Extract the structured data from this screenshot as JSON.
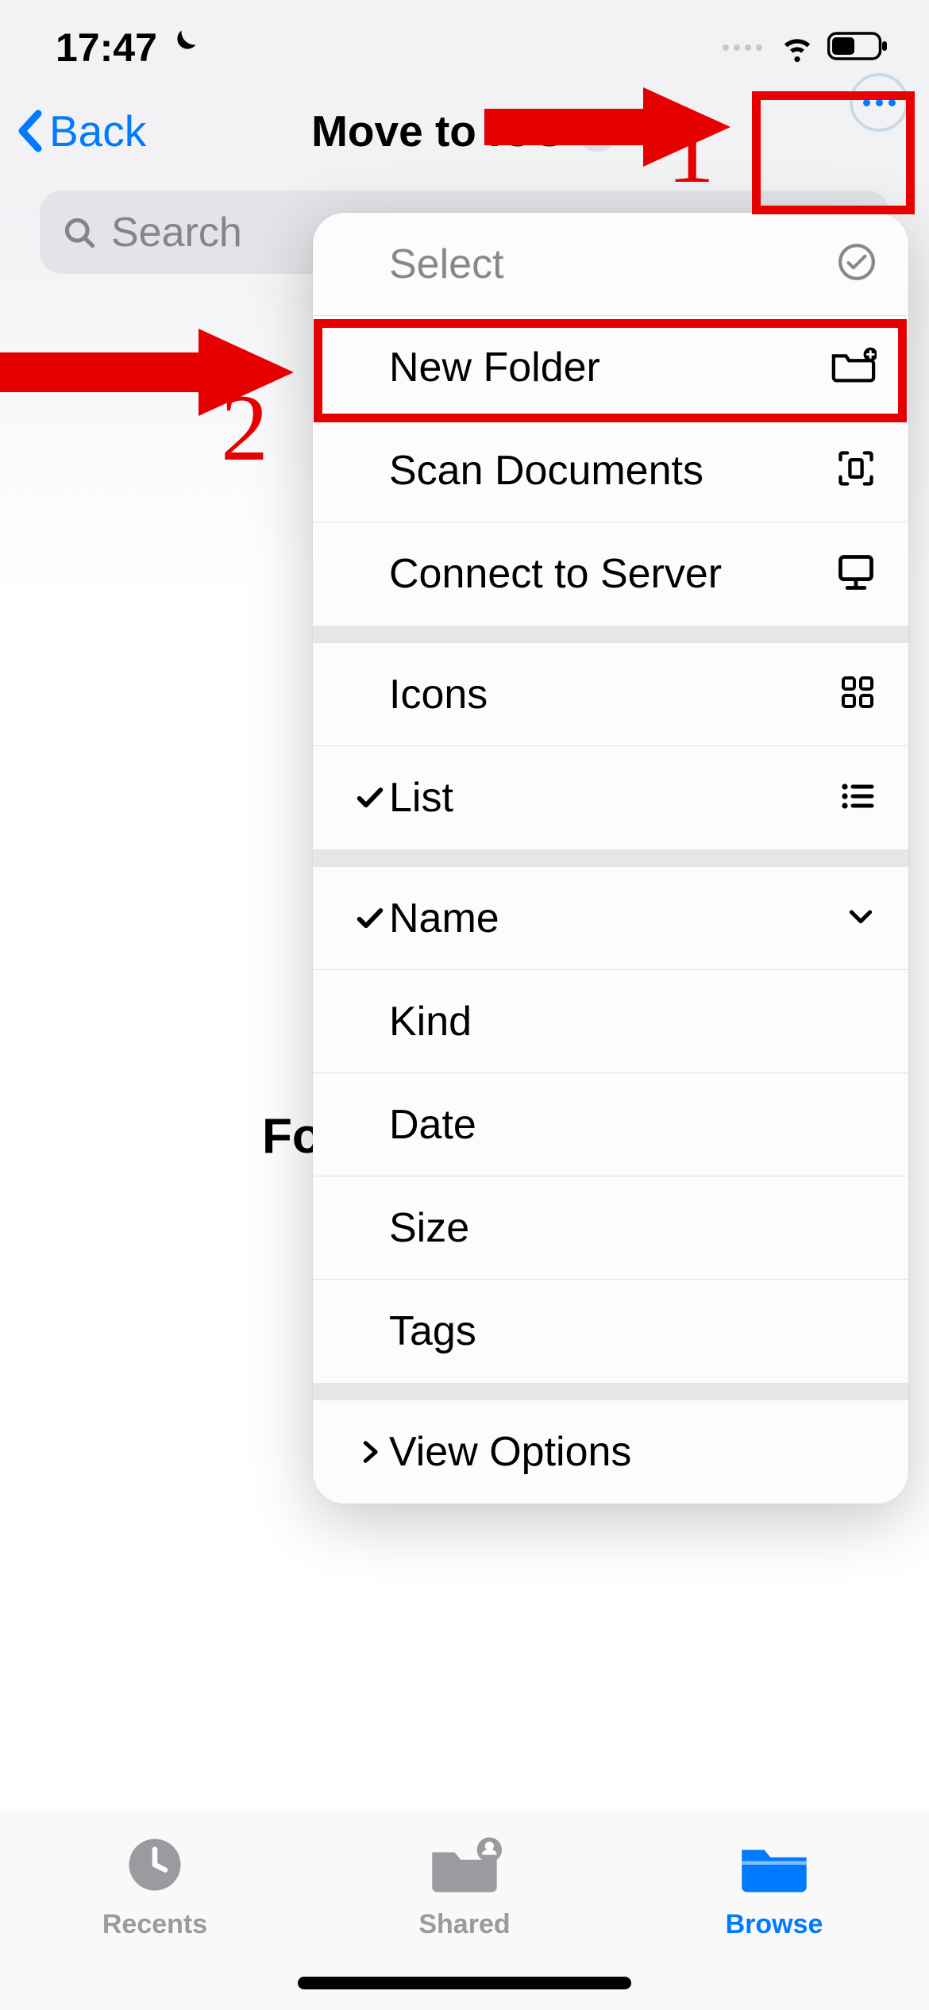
{
  "status": {
    "time": "17:47"
  },
  "nav": {
    "back_label": "Back",
    "title": "Move to iOS"
  },
  "search": {
    "placeholder": "Search"
  },
  "background": {
    "truncated_text": "Fo"
  },
  "menu": {
    "select": "Select",
    "new_folder": "New Folder",
    "scan_documents": "Scan Documents",
    "connect_server": "Connect to Server",
    "icons": "Icons",
    "list": "List",
    "name": "Name",
    "kind": "Kind",
    "date": "Date",
    "size": "Size",
    "tags": "Tags",
    "view_options": "View Options"
  },
  "tabs": {
    "recents": "Recents",
    "shared": "Shared",
    "browse": "Browse"
  },
  "annotations": {
    "n1": "1",
    "n2": "2"
  }
}
